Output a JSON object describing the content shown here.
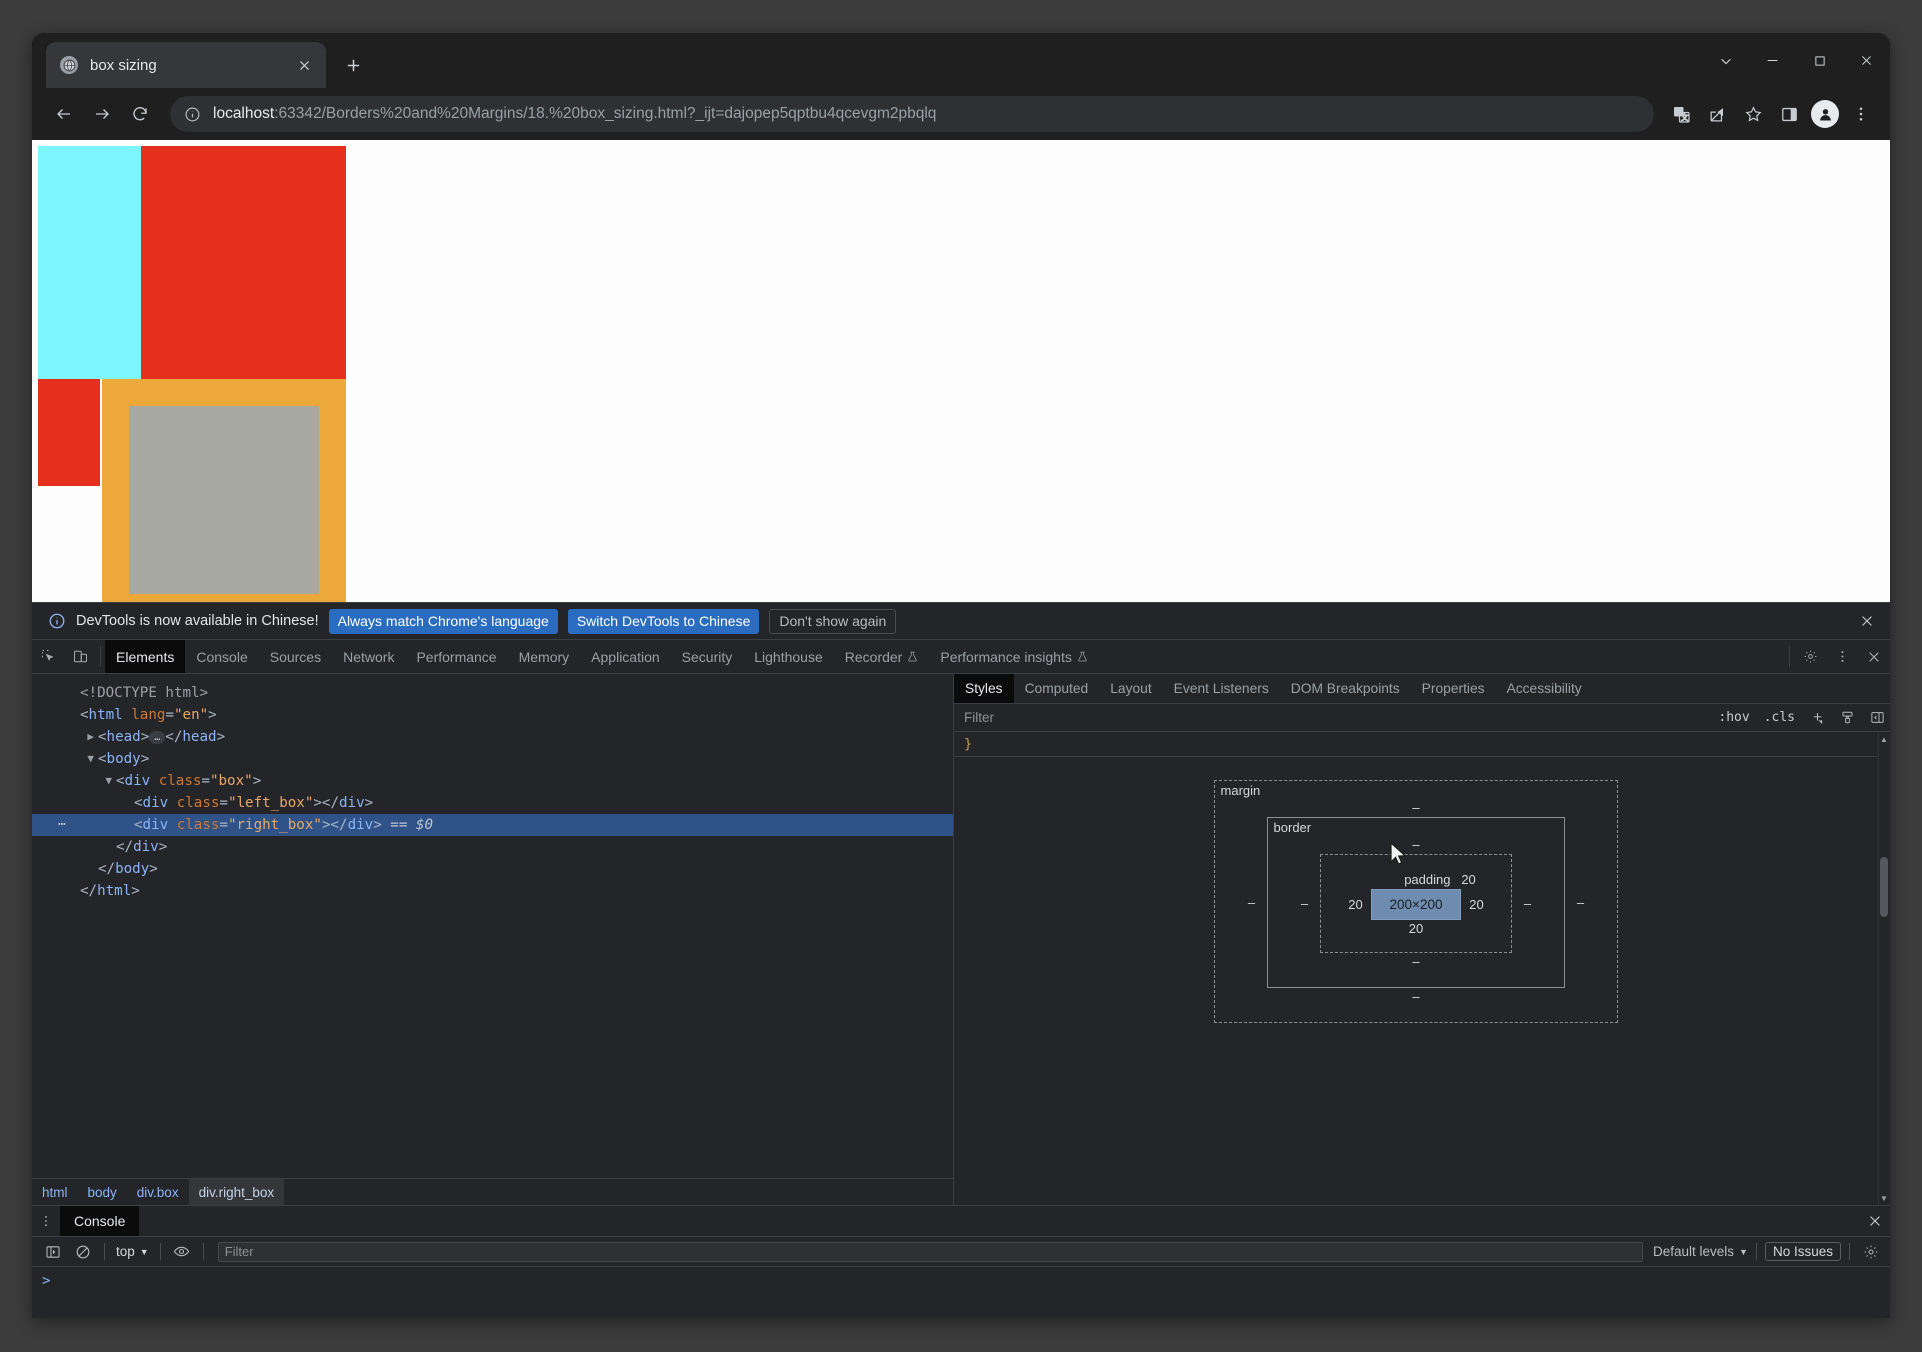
{
  "browser": {
    "tab": {
      "title": "box sizing",
      "favicon_icon": "globe-icon",
      "close_icon": "close-icon"
    },
    "new_tab_icon": "plus-icon",
    "window_controls": {
      "search_tabs_icon": "chevron-down-icon",
      "minimize_icon": "minimize-icon",
      "maximize_icon": "maximize-icon",
      "close_icon": "close-icon"
    },
    "nav": {
      "back_icon": "arrow-left-icon",
      "forward_icon": "arrow-right-icon",
      "reload_icon": "reload-icon",
      "info_icon": "info-circle-icon",
      "url_host": "localhost",
      "url_rest": ":63342/Borders%20and%20Margins/18.%20box_sizing.html?_ijt=dajopep5qptbu4qcevgm2pbqlq",
      "url_full": "localhost:63342/Borders%20and%20Margins/18.%20box_sizing.html?_ijt=dajopep5qptbu4qcevgm2pbqlq",
      "translate_icon": "translate-icon",
      "share_icon": "share-icon",
      "bookmark_icon": "star-icon",
      "side_panel_icon": "side-panel-icon",
      "profile_icon": "person-avatar-icon",
      "menu_icon": "three-dots-vertical-icon"
    }
  },
  "page": {
    "colors": {
      "background": "#fdfdfd",
      "left_box": "#7df7fd",
      "right_box_border": "#eda83c",
      "right_box_content": "#a8a8a3",
      "box_background": "#e6301e"
    }
  },
  "devtools": {
    "notification": {
      "icon": "info-circle-icon",
      "message": "DevTools is now available in Chinese!",
      "primary_button": "Always match Chrome's language",
      "secondary_button": "Switch DevTools to Chinese",
      "dismiss_button": "Don't show again",
      "close_icon": "close-icon"
    },
    "toolbar": {
      "inspect_icon": "inspect-element-icon",
      "device_toolbar_icon": "device-toggle-icon",
      "settings_icon": "gear-icon",
      "more_icon": "three-dots-vertical-icon",
      "close_icon": "close-icon"
    },
    "tabs": [
      {
        "label": "Elements",
        "active": true,
        "badge": ""
      },
      {
        "label": "Console",
        "active": false,
        "badge": ""
      },
      {
        "label": "Sources",
        "active": false,
        "badge": ""
      },
      {
        "label": "Network",
        "active": false,
        "badge": ""
      },
      {
        "label": "Performance",
        "active": false,
        "badge": ""
      },
      {
        "label": "Memory",
        "active": false,
        "badge": ""
      },
      {
        "label": "Application",
        "active": false,
        "badge": ""
      },
      {
        "label": "Security",
        "active": false,
        "badge": ""
      },
      {
        "label": "Lighthouse",
        "active": false,
        "badge": ""
      },
      {
        "label": "Recorder",
        "active": false,
        "badge": "flask-icon"
      },
      {
        "label": "Performance insights",
        "active": false,
        "badge": "flask-icon"
      }
    ],
    "dom_tree": [
      {
        "indent": 0,
        "arrow": "",
        "selected": false,
        "marker": false,
        "tokens": [
          {
            "t": "doctype",
            "v": "<!DOCTYPE html>"
          }
        ]
      },
      {
        "indent": 0,
        "arrow": "",
        "selected": false,
        "marker": false,
        "tokens": [
          {
            "t": "punct",
            "v": "<"
          },
          {
            "t": "tag",
            "v": "html"
          },
          {
            "t": "attr",
            "v": " lang"
          },
          {
            "t": "punct",
            "v": "="
          },
          {
            "t": "val",
            "v": "\"en\""
          },
          {
            "t": "punct",
            "v": ">"
          }
        ]
      },
      {
        "indent": 1,
        "arrow": "collapsed",
        "selected": false,
        "marker": false,
        "tokens": [
          {
            "t": "punct",
            "v": "<"
          },
          {
            "t": "tag",
            "v": "head"
          },
          {
            "t": "punct",
            "v": ">"
          },
          {
            "t": "badge",
            "v": "…"
          },
          {
            "t": "punct",
            "v": "</"
          },
          {
            "t": "tag",
            "v": "head"
          },
          {
            "t": "punct",
            "v": ">"
          }
        ]
      },
      {
        "indent": 1,
        "arrow": "expanded",
        "selected": false,
        "marker": false,
        "tokens": [
          {
            "t": "punct",
            "v": "<"
          },
          {
            "t": "tag",
            "v": "body"
          },
          {
            "t": "punct",
            "v": ">"
          }
        ]
      },
      {
        "indent": 2,
        "arrow": "expanded",
        "selected": false,
        "marker": false,
        "tokens": [
          {
            "t": "punct",
            "v": "<"
          },
          {
            "t": "tag",
            "v": "div"
          },
          {
            "t": "attr",
            "v": " class"
          },
          {
            "t": "punct",
            "v": "="
          },
          {
            "t": "val",
            "v": "\"box\""
          },
          {
            "t": "punct",
            "v": ">"
          }
        ]
      },
      {
        "indent": 3,
        "arrow": "",
        "selected": false,
        "marker": false,
        "tokens": [
          {
            "t": "punct",
            "v": "<"
          },
          {
            "t": "tag",
            "v": "div"
          },
          {
            "t": "attr",
            "v": " class"
          },
          {
            "t": "punct",
            "v": "="
          },
          {
            "t": "val",
            "v": "\"left_box\""
          },
          {
            "t": "punct",
            "v": "></"
          },
          {
            "t": "tag",
            "v": "div"
          },
          {
            "t": "punct",
            "v": ">"
          }
        ]
      },
      {
        "indent": 3,
        "arrow": "",
        "selected": true,
        "marker": true,
        "tokens": [
          {
            "t": "punct",
            "v": "<"
          },
          {
            "t": "tag",
            "v": "div"
          },
          {
            "t": "attr",
            "v": " class"
          },
          {
            "t": "punct",
            "v": "="
          },
          {
            "t": "val",
            "v": "\"right_box\""
          },
          {
            "t": "punct",
            "v": "></"
          },
          {
            "t": "tag",
            "v": "div"
          },
          {
            "t": "punct",
            "v": ">"
          },
          {
            "t": "dollar",
            "v": " == $0"
          }
        ]
      },
      {
        "indent": 2,
        "arrow": "",
        "selected": false,
        "marker": false,
        "tokens": [
          {
            "t": "punct",
            "v": "</"
          },
          {
            "t": "tag",
            "v": "div"
          },
          {
            "t": "punct",
            "v": ">"
          }
        ]
      },
      {
        "indent": 1,
        "arrow": "",
        "selected": false,
        "marker": false,
        "tokens": [
          {
            "t": "punct",
            "v": "</"
          },
          {
            "t": "tag",
            "v": "body"
          },
          {
            "t": "punct",
            "v": ">"
          }
        ]
      },
      {
        "indent": 0,
        "arrow": "",
        "selected": false,
        "marker": false,
        "tokens": [
          {
            "t": "punct",
            "v": "</"
          },
          {
            "t": "tag",
            "v": "html"
          },
          {
            "t": "punct",
            "v": ">"
          }
        ]
      }
    ],
    "breadcrumb": [
      {
        "label": "html",
        "active": false
      },
      {
        "label": "body",
        "active": false
      },
      {
        "label": "div.box",
        "active": false
      },
      {
        "label": "div.right_box",
        "active": true
      }
    ],
    "styles_pane": {
      "tabs": [
        {
          "label": "Styles",
          "active": true
        },
        {
          "label": "Computed",
          "active": false
        },
        {
          "label": "Layout",
          "active": false
        },
        {
          "label": "Event Listeners",
          "active": false
        },
        {
          "label": "DOM Breakpoints",
          "active": false
        },
        {
          "label": "Properties",
          "active": false
        },
        {
          "label": "Accessibility",
          "active": false
        }
      ],
      "filter_placeholder": "Filter",
      "filter_value": "",
      "hover_button": ":hov",
      "cls_button": ".cls",
      "new_rule_icon": "plus-icon",
      "styles_paste_icon": "paintbrush-icon",
      "sidebar_toggle_icon": "panel-toggle-icon",
      "rule_text": "}"
    },
    "box_model": {
      "margin_label": "margin",
      "border_label": "border",
      "padding_label": "padding",
      "margin_top": "–",
      "margin_right": "–",
      "margin_bottom": "–",
      "margin_left": "–",
      "border_top": "–",
      "border_right": "–",
      "border_bottom": "–",
      "border_left": "–",
      "padding_top": "20",
      "padding_right": "20",
      "padding_bottom": "20",
      "padding_left": "20",
      "content_size": "200×200",
      "cursor_icon": "mouse-pointer-icon"
    },
    "drawer": {
      "menu_icon": "three-dots-vertical-icon",
      "tab_label": "Console",
      "close_icon": "close-icon",
      "sidebar_icon": "console-sidebar-icon",
      "clear_icon": "clear-console-icon",
      "context_label": "top",
      "context_caret_icon": "chevron-down-icon",
      "eye_icon": "eye-icon",
      "filter_placeholder": "Filter",
      "filter_value": "",
      "levels_label": "Default levels",
      "levels_caret_icon": "chevron-down-icon",
      "issues_label": "No Issues",
      "settings_icon": "gear-icon",
      "prompt_symbol": ">"
    }
  }
}
